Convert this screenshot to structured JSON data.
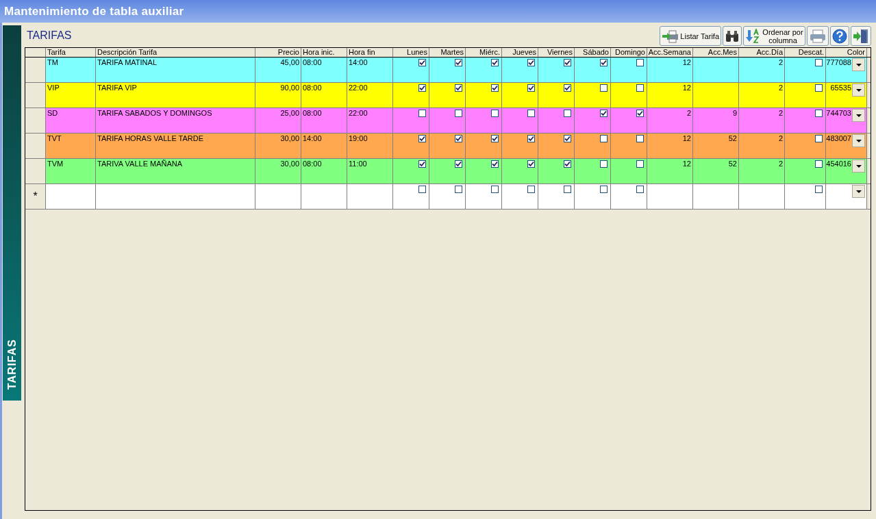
{
  "window": {
    "title": "Mantenimiento de tabla auxiliar"
  },
  "side_tab": {
    "label": "TARIFAS"
  },
  "heading": "TARIFAS",
  "toolbar": [
    {
      "kind": "list",
      "label": "Listar Tarifa"
    },
    {
      "kind": "find"
    },
    {
      "kind": "sort",
      "label": "Ordenar por columna"
    },
    {
      "kind": "print"
    },
    {
      "kind": "help"
    },
    {
      "kind": "exit"
    }
  ],
  "table": {
    "columns": [
      "Tarifa",
      "Descripción Tarifa",
      "Precio",
      "Hora inic.",
      "Hora fin",
      "Lunes",
      "Martes",
      "Miérc.",
      "Jueves",
      "Viernes",
      "Sábado",
      "Domingo",
      "Acc.Semana",
      "Acc.Mes",
      "Acc.Día",
      "Descat.",
      "Color"
    ],
    "rows": [
      {
        "color": "#80ffff",
        "code": "TM",
        "description": "TARIFA MATINAL",
        "price": "45,00",
        "start": "08:00",
        "end": "14:00",
        "days": [
          true,
          true,
          true,
          true,
          true,
          true,
          false
        ],
        "acc_week": "12",
        "acc_month": "",
        "acc_day": "2",
        "discontinued": false,
        "color_code": "777088"
      },
      {
        "color": "#ffff00",
        "code": "VIP",
        "description": "TARIFA VIP",
        "price": "90,00",
        "start": "08:00",
        "end": "22:00",
        "days": [
          true,
          true,
          true,
          true,
          true,
          false,
          false
        ],
        "acc_week": "12",
        "acc_month": "",
        "acc_day": "2",
        "discontinued": false,
        "color_code": "65535"
      },
      {
        "color": "#ff80ff",
        "code": "SD",
        "description": "TARIFA SABADOS Y DOMINGOS",
        "price": "25,00",
        "start": "08:00",
        "end": "22:00",
        "days": [
          false,
          false,
          false,
          false,
          false,
          true,
          true
        ],
        "acc_week": "2",
        "acc_month": "9",
        "acc_day": "2",
        "discontinued": false,
        "color_code": "744703"
      },
      {
        "color": "#ffa850",
        "code": "TVT",
        "description": "TARIFA HORAS VALLE TARDE",
        "price": "30,00",
        "start": "14:00",
        "end": "19:00",
        "days": [
          true,
          true,
          true,
          true,
          true,
          false,
          false
        ],
        "acc_week": "12",
        "acc_month": "52",
        "acc_day": "2",
        "discontinued": false,
        "color_code": "483007"
      },
      {
        "color": "#80ff80",
        "code": "TVM",
        "description": "TARIVA VALLE MAÑANA",
        "price": "30,00",
        "start": "08:00",
        "end": "11:00",
        "days": [
          true,
          true,
          true,
          true,
          true,
          false,
          false
        ],
        "acc_week": "12",
        "acc_month": "52",
        "acc_day": "2",
        "discontinued": false,
        "color_code": "454016"
      }
    ],
    "new_row": {
      "marker": "*",
      "days": [
        false,
        false,
        false,
        false,
        false,
        false,
        false
      ],
      "discontinued": false
    }
  }
}
